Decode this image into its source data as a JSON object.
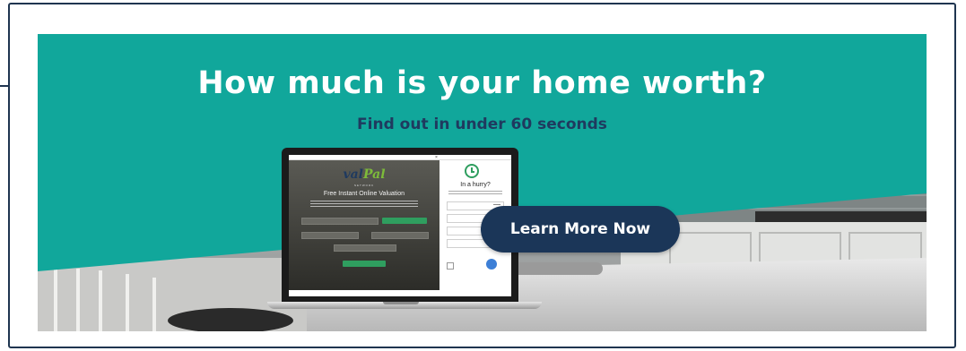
{
  "banner": {
    "headline": "How much is your home worth?",
    "subheadline": "Find out in under 60 seconds",
    "cta_label": "Learn More Now",
    "colors": {
      "teal": "#11a79b",
      "navy": "#1b3658",
      "subhead": "#1f3a5f"
    }
  },
  "screen": {
    "logo_main": "val",
    "logo_accent": "Pal",
    "logo_sub": "NETWORK",
    "title": "Free Instant Online Valuation",
    "side_title": "In a hurry?",
    "clock_icon": "clock-icon"
  }
}
